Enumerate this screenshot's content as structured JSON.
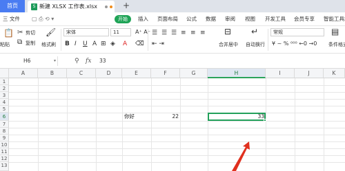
{
  "tabs": {
    "home": "首页",
    "file_name": "新建 XLSX 工作表.xlsx",
    "add": "+"
  },
  "menu": {
    "file": "三 文件",
    "start": "开始",
    "items": [
      "插入",
      "页面布局",
      "公式",
      "数据",
      "审阅",
      "视图",
      "开发工具",
      "会员专享",
      "智能工具箱"
    ]
  },
  "ribbon": {
    "cut": "剪切",
    "paste": "粘贴",
    "copy": "复制",
    "format_painter": "格式刷",
    "font_name": "宋体",
    "font_size": "11",
    "merge_center": "合并居中",
    "wrap_text": "自动换行",
    "number_format": "常规",
    "conditional_format": "条件格式"
  },
  "formula_bar": {
    "cell_ref": "H6",
    "fx": "fx",
    "value": "33"
  },
  "grid": {
    "columns": [
      "A",
      "B",
      "C",
      "D",
      "E",
      "F",
      "G",
      "H",
      "I",
      "J",
      "K"
    ],
    "rows": [
      "1",
      "2",
      "3",
      "4",
      "5",
      "6",
      "7",
      "8",
      "9",
      "10",
      "11",
      "12",
      "13"
    ],
    "selected_column": "H",
    "selected_row": "6",
    "cells": {
      "E6": "你好",
      "F6": "22",
      "H6": "33"
    }
  },
  "colors": {
    "accent_green": "#1ea356",
    "home_tab_blue": "#4a7cf2",
    "annotation_arrow": "#e0301e"
  }
}
